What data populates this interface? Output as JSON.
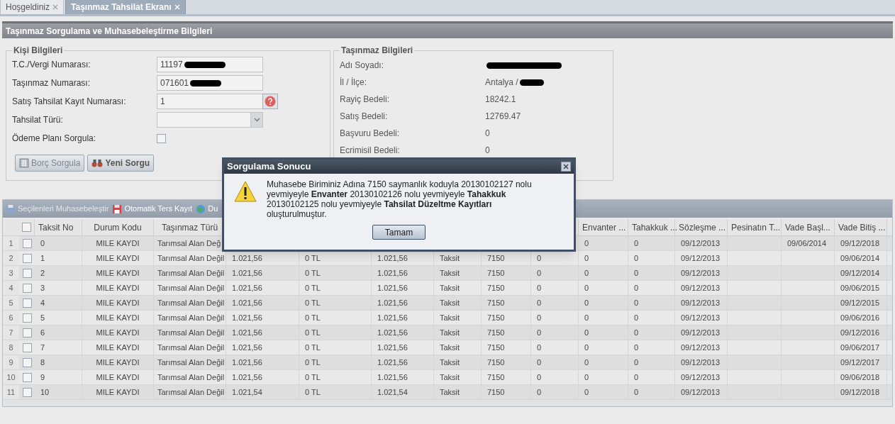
{
  "tabs": [
    {
      "label": "Hoşgeldiniz",
      "selected": false
    },
    {
      "label": "Taşınmaz Tahsilat Ekranı",
      "selected": true
    }
  ],
  "panel_title": "Taşınmaz Sorgulama ve Muhasebeleştirme Bilgileri",
  "person": {
    "legend": "Kişi Bilgileri",
    "fields": [
      {
        "kind": "text",
        "label": "T.C./Vergi Numarası:",
        "value": "11197",
        "redacted": true
      },
      {
        "kind": "text",
        "label": "Taşınmaz Numarası:",
        "value": "071601",
        "redacted": true
      },
      {
        "kind": "help",
        "label": "Satış Tahsilat Kayıt Numarası:",
        "value": "1"
      },
      {
        "kind": "select",
        "label": "Tahsilat Türü:"
      },
      {
        "kind": "checkbox",
        "label": "Ödeme Planı Sorgula:",
        "checked": false
      }
    ],
    "buttons": [
      {
        "label": "Borç Sorgula",
        "kind": "debt",
        "disabled": true
      },
      {
        "label": "Yeni Sorgu",
        "kind": "new",
        "disabled": false
      }
    ]
  },
  "property": {
    "legend": "Taşınmaz Bilgileri",
    "rows": [
      {
        "label": "Adı Soyadı:",
        "redacted": true
      },
      {
        "label": "İl / İlçe:",
        "value": "Antalya /",
        "redacted": true
      },
      {
        "label": "Rayiç Bedeli:",
        "value": "18242.1"
      },
      {
        "label": "Satış Bedeli:",
        "value": "12769.47"
      },
      {
        "label": "Başvuru Bedeli:",
        "value": "0"
      },
      {
        "label": "Ecrimisil Bedeli:",
        "value": "0"
      }
    ]
  },
  "toolbar": [
    {
      "label": "Seçilenleri Muhasebeleştir",
      "kind": "save",
      "disabled": true
    },
    {
      "label": "Otomatik Ters Kayıt",
      "kind": "reverse",
      "disabled": false
    },
    {
      "label": "Du",
      "kind": "globe",
      "disabled": false
    }
  ],
  "table": {
    "header_checked": false,
    "columns": [
      "Taksit No",
      "Durum Kodu",
      "Taşınmaz Türü",
      null,
      null,
      null,
      null,
      null,
      null,
      "Envanter ...",
      "Tahakkuk ...",
      "Sözleşme ...",
      "Pesinatın T...",
      "Vade Başl...",
      "Vade Bitiş ..."
    ],
    "rows": [
      {
        "number": "1",
        "checked": false,
        "cells": [
          "0",
          "MILE KAYDI",
          "Tarımsal Alan Değ",
          null,
          null,
          null,
          null,
          null,
          null,
          "0",
          "0",
          "09/12/2013",
          "",
          "09/06/2014",
          "09/12/2018"
        ]
      },
      {
        "number": "2",
        "checked": false,
        "cells": [
          "1",
          "MILE KAYDI",
          "Tarımsal Alan Değil",
          "1.021,56",
          "0 TL",
          "1.021,56",
          "Taksit",
          "7150",
          "0",
          "0",
          "0",
          "09/12/2013",
          "",
          "",
          "09/06/2014"
        ]
      },
      {
        "number": "3",
        "checked": false,
        "cells": [
          "2",
          "MILE KAYDI",
          "Tarımsal Alan Değil",
          "1.021,56",
          "0 TL",
          "1.021,56",
          "Taksit",
          "7150",
          "0",
          "0",
          "0",
          "09/12/2013",
          "",
          "",
          "09/12/2014"
        ]
      },
      {
        "number": "4",
        "checked": false,
        "cells": [
          "3",
          "MILE KAYDI",
          "Tarımsal Alan Değil",
          "1.021,56",
          "0 TL",
          "1.021,56",
          "Taksit",
          "7150",
          "0",
          "0",
          "0",
          "09/12/2013",
          "",
          "",
          "09/06/2015"
        ]
      },
      {
        "number": "5",
        "checked": false,
        "cells": [
          "4",
          "MILE KAYDI",
          "Tarımsal Alan Değil",
          "1.021,56",
          "0 TL",
          "1.021,56",
          "Taksit",
          "7150",
          "0",
          "0",
          "0",
          "09/12/2013",
          "",
          "",
          "09/12/2015"
        ]
      },
      {
        "number": "6",
        "checked": false,
        "cells": [
          "5",
          "MILE KAYDI",
          "Tarımsal Alan Değil",
          "1.021,56",
          "0 TL",
          "1.021,56",
          "Taksit",
          "7150",
          "0",
          "0",
          "0",
          "09/12/2013",
          "",
          "",
          "09/06/2016"
        ]
      },
      {
        "number": "7",
        "checked": false,
        "cells": [
          "6",
          "MILE KAYDI",
          "Tarımsal Alan Değil",
          "1.021,56",
          "0 TL",
          "1.021,56",
          "Taksit",
          "7150",
          "0",
          "0",
          "0",
          "09/12/2013",
          "",
          "",
          "09/12/2016"
        ]
      },
      {
        "number": "8",
        "checked": false,
        "cells": [
          "7",
          "MILE KAYDI",
          "Tarımsal Alan Değil",
          "1.021,56",
          "0 TL",
          "1.021,56",
          "Taksit",
          "7150",
          "0",
          "0",
          "0",
          "09/12/2013",
          "",
          "",
          "09/06/2017"
        ]
      },
      {
        "number": "9",
        "checked": false,
        "cells": [
          "8",
          "MILE KAYDI",
          "Tarımsal Alan Değil",
          "1.021,56",
          "0 TL",
          "1.021,56",
          "Taksit",
          "7150",
          "0",
          "0",
          "0",
          "09/12/2013",
          "",
          "",
          "09/12/2017"
        ]
      },
      {
        "number": "10",
        "checked": false,
        "cells": [
          "9",
          "MILE KAYDI",
          "Tarımsal Alan Değil",
          "1.021,56",
          "0 TL",
          "1.021,56",
          "Taksit",
          "7150",
          "0",
          "0",
          "0",
          "09/12/2013",
          "",
          "",
          "09/06/2018"
        ]
      },
      {
        "number": "11",
        "checked": false,
        "cells": [
          "10",
          "MILE KAYDI",
          "Tarımsal Alan Değil",
          "1.021,54",
          "0 TL",
          "1.021,54",
          "Taksit",
          "7150",
          "0",
          "0",
          "0",
          "09/12/2013",
          "",
          "",
          "09/12/2018"
        ]
      }
    ]
  },
  "dialog": {
    "title": "Sorgulama Sonucu",
    "message": "Muhasebe Biriminiz Adına 7150 saymanlık koduyla 20130102127 nolu yevmiyeyle **Envanter** 20130102126 nolu yevmiyeyle **Tahakkuk** 20130102125 nolu yevmiyeyle **Tahsilat Düzeltme Kayıtları** oluşturulmuştur.",
    "button": "Tamam"
  }
}
